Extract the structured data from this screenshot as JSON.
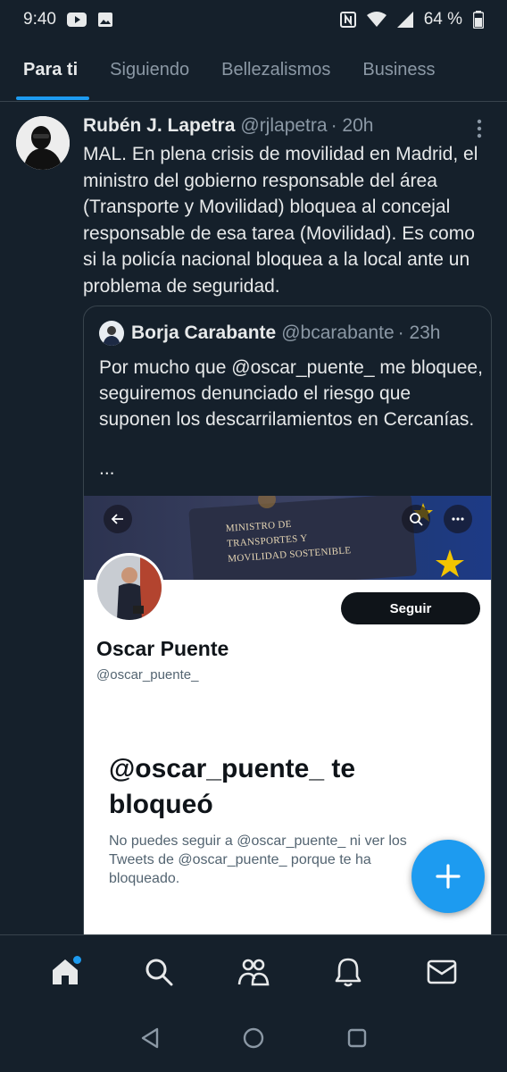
{
  "status_bar": {
    "time": "9:40",
    "battery": "64 %",
    "icons": [
      "youtube-icon",
      "gallery-icon",
      "nfc-icon",
      "wifi-icon",
      "signal-icon",
      "battery-icon"
    ]
  },
  "tabs": [
    {
      "label": "Para ti",
      "active": true
    },
    {
      "label": "Siguiendo",
      "active": false
    },
    {
      "label": "Bellezalismos",
      "active": false
    },
    {
      "label": "Business",
      "active": false
    }
  ],
  "tweet": {
    "author_name": "Rubén J. Lapetra",
    "author_handle": "@rjlapetra",
    "time": "· 20h",
    "text": "MAL. En plena crisis de movilidad en Madrid, el ministro del gobierno responsable del área (Transporte y Movilidad) bloquea al concejal responsable de esa tarea (Movilidad). Es como si la policía nacional bloquea a la local ante un problema de seguridad."
  },
  "quote": {
    "author_name": "Borja Carabante",
    "author_handle": "@bcarabante",
    "time": "· 23h",
    "text": "Por mucho que @oscar_puente_ me bloquee, seguiremos denunciado el riesgo que suponen los descarrilamientos en Cercanías.",
    "ellipsis": "...",
    "screenshot": {
      "banner_text": "MINISTRO DE TRANSPORTES Y MOVILIDAD SOSTENIBLE",
      "follow_label": "Seguir",
      "profile_name": "Oscar Puente",
      "profile_handle": "@oscar_puente_",
      "blocked_title": "@oscar_puente_ te bloqueó",
      "blocked_desc": "No puedes seguir a @oscar_puente_ ni ver los Tweets de @oscar_puente_ porque te ha bloqueado."
    }
  },
  "colors": {
    "background": "#15202b",
    "accent": "#1d9bf0",
    "text_primary": "#e7e9ea",
    "text_secondary": "#8b98a5",
    "border": "#38444d"
  },
  "bottom_nav": [
    "home-icon",
    "search-icon",
    "communities-icon",
    "notifications-icon",
    "messages-icon"
  ],
  "system_nav": [
    "back-icon",
    "home-circle-icon",
    "recents-icon"
  ]
}
